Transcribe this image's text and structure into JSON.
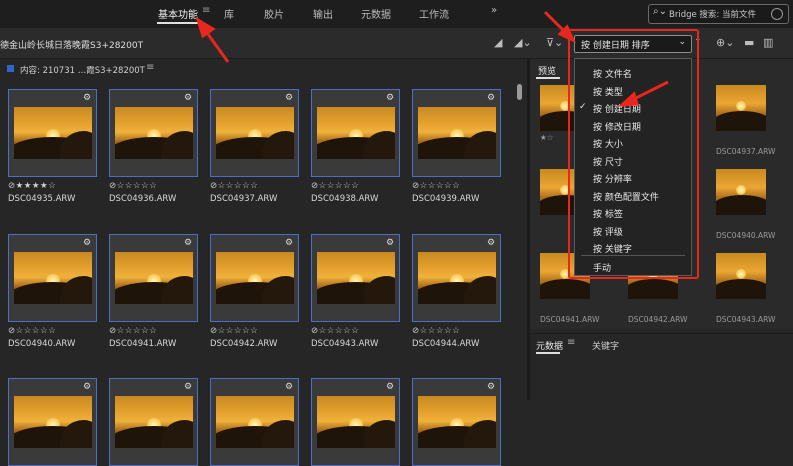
{
  "topbar": {
    "workspaces": [
      {
        "label": "基本功能",
        "active": true
      },
      {
        "label": "库"
      },
      {
        "label": "胶片"
      },
      {
        "label": "输出"
      },
      {
        "label": "元数据"
      },
      {
        "label": "工作流"
      }
    ],
    "menu_glyph": "≡",
    "more_glyph": "»",
    "search_placeholder": "Bridge 搜索: 当前文件"
  },
  "pathbar": {
    "path": "德金山岭长城日落晚霞S3+28200T",
    "sort_label": "按 创建日期 排序"
  },
  "content_panel": {
    "title": "内容: 210731 …霞S3+28200T",
    "menu_glyph": "≡"
  },
  "thumbnails": [
    {
      "file": "DSC04935.ARW",
      "stars": "⊘★★★★☆"
    },
    {
      "file": "DSC04936.ARW",
      "stars": "⊘☆☆☆☆☆"
    },
    {
      "file": "DSC04937.ARW",
      "stars": "⊘☆☆☆☆☆"
    },
    {
      "file": "DSC04938.ARW",
      "stars": "⊘☆☆☆☆☆"
    },
    {
      "file": "DSC04939.ARW",
      "stars": "⊘☆☆☆☆☆"
    },
    {
      "file": "DSC04940.ARW",
      "stars": "⊘☆☆☆☆☆"
    },
    {
      "file": "DSC04941.ARW",
      "stars": "⊘☆☆☆☆☆"
    },
    {
      "file": "DSC04942.ARW",
      "stars": "⊘☆☆☆☆☆"
    },
    {
      "file": "DSC04943.ARW",
      "stars": "⊘☆☆☆☆☆"
    },
    {
      "file": "DSC04944.ARW",
      "stars": "⊘☆☆☆☆☆"
    },
    {
      "file": "",
      "stars": ""
    },
    {
      "file": "",
      "stars": ""
    },
    {
      "file": "",
      "stars": ""
    },
    {
      "file": "",
      "stars": ""
    },
    {
      "file": "",
      "stars": ""
    }
  ],
  "preview_panel": {
    "tab": "预览",
    "labels": [
      "DSC04937.ARW",
      "DSC04940.ARW",
      "DSC04941.ARW",
      "DSC04942.ARW",
      "DSC04943.ARW",
      "★☆"
    ]
  },
  "meta_panel": {
    "tab": "元数据",
    "menu_glyph": "≡",
    "keywords_tab": "关键字"
  },
  "sort_dropdown": {
    "items": [
      {
        "label": "按 文件名",
        "checked": false
      },
      {
        "label": "按 类型",
        "checked": false
      },
      {
        "label": "按 创建日期",
        "checked": true
      },
      {
        "label": "按 修改日期",
        "checked": false
      },
      {
        "label": "按 大小",
        "checked": false
      },
      {
        "label": "按 尺寸",
        "checked": false
      },
      {
        "label": "按 分辨率",
        "checked": false
      },
      {
        "label": "按 颜色配置文件",
        "checked": false
      },
      {
        "label": "按 标签",
        "checked": false
      },
      {
        "label": "按 评级",
        "checked": false
      },
      {
        "label": "按 关键字",
        "checked": false
      }
    ],
    "manual": "手动",
    "check_glyph": "✓"
  },
  "icons": {
    "search": "search-icon",
    "sort_chevron": "chevron-down-icon",
    "filter": "filter-icon",
    "folder": "folder-icon",
    "trash": "trash-icon"
  },
  "colors": {
    "accent_blue": "#4b6ec9",
    "annotation_red": "#e8271e"
  }
}
